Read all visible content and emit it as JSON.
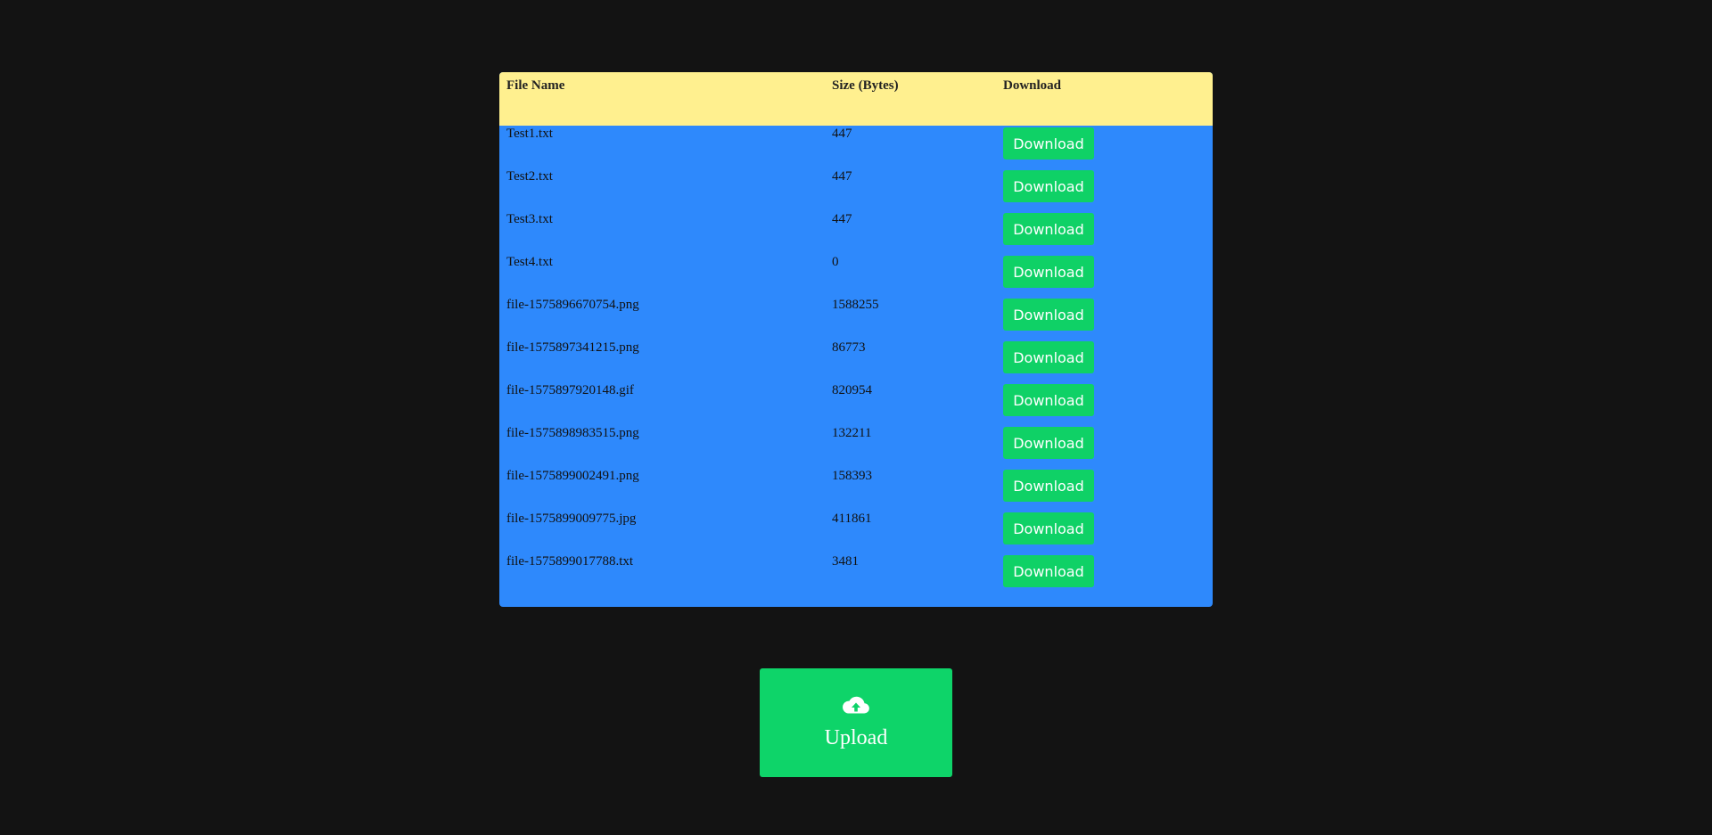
{
  "table": {
    "headers": {
      "name": "File Name",
      "size": "Size (Bytes)",
      "download": "Download"
    },
    "rows": [
      {
        "name": "Test1.txt",
        "size": "447",
        "button": "Download"
      },
      {
        "name": "Test2.txt",
        "size": "447",
        "button": "Download"
      },
      {
        "name": "Test3.txt",
        "size": "447",
        "button": "Download"
      },
      {
        "name": "Test4.txt",
        "size": "0",
        "button": "Download"
      },
      {
        "name": "file-1575896670754.png",
        "size": "1588255",
        "button": "Download"
      },
      {
        "name": "file-1575897341215.png",
        "size": "86773",
        "button": "Download"
      },
      {
        "name": "file-1575897920148.gif",
        "size": "820954",
        "button": "Download"
      },
      {
        "name": "file-1575898983515.png",
        "size": "132211",
        "button": "Download"
      },
      {
        "name": "file-1575899002491.png",
        "size": "158393",
        "button": "Download"
      },
      {
        "name": "file-1575899009775.jpg",
        "size": "411861",
        "button": "Download"
      },
      {
        "name": "file-1575899017788.txt",
        "size": "3481",
        "button": "Download"
      }
    ]
  },
  "upload": {
    "label": "Upload",
    "icon": "cloud-upload-icon"
  },
  "colors": {
    "background": "#131313",
    "header": "#fff08f",
    "table_body": "#2e89fc",
    "button": "#0fd166"
  }
}
